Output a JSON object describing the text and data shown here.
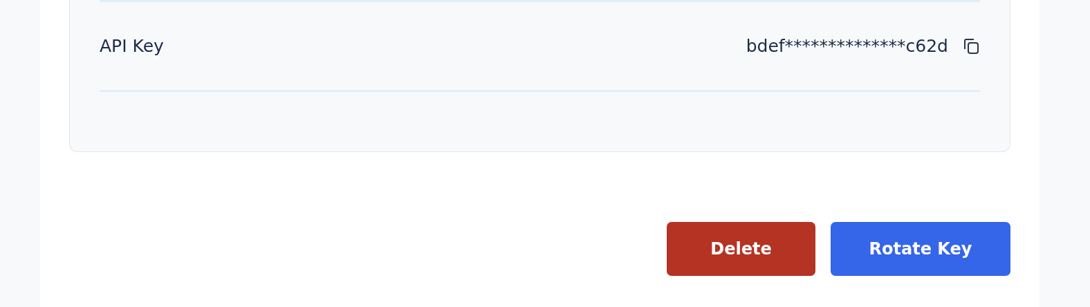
{
  "details": [
    {
      "label": "API Key",
      "value": "bdef**************c62d"
    }
  ],
  "buttons": [
    {
      "label": "Delete",
      "kind": "danger"
    },
    {
      "label": "Rotate Key",
      "kind": "primary"
    }
  ]
}
